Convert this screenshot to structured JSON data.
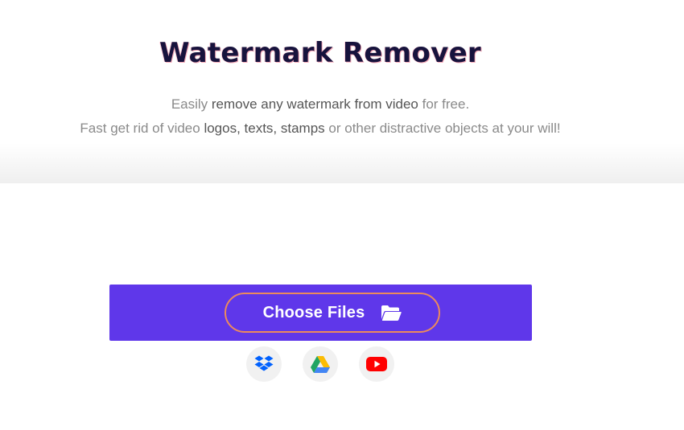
{
  "hero": {
    "title": "Watermark Remover",
    "line1": {
      "a": "Easily ",
      "b": "remove any watermark from video",
      "c": " for free."
    },
    "line2": {
      "a": "Fast get rid of video ",
      "b": "logos, texts, stamps",
      "c": " or other distractive objects at your will!"
    }
  },
  "upload": {
    "button_label": "Choose Files",
    "button_icon": "folder-open-icon",
    "accent_color": "#5f37ea",
    "button_border_color": "#ec8a5c"
  },
  "sources": [
    {
      "icon": "dropbox-icon",
      "color": "#0061fe"
    },
    {
      "icon": "google-drive-icon",
      "color": "#1fa463"
    },
    {
      "icon": "youtube-icon",
      "color": "#ff0000"
    }
  ]
}
